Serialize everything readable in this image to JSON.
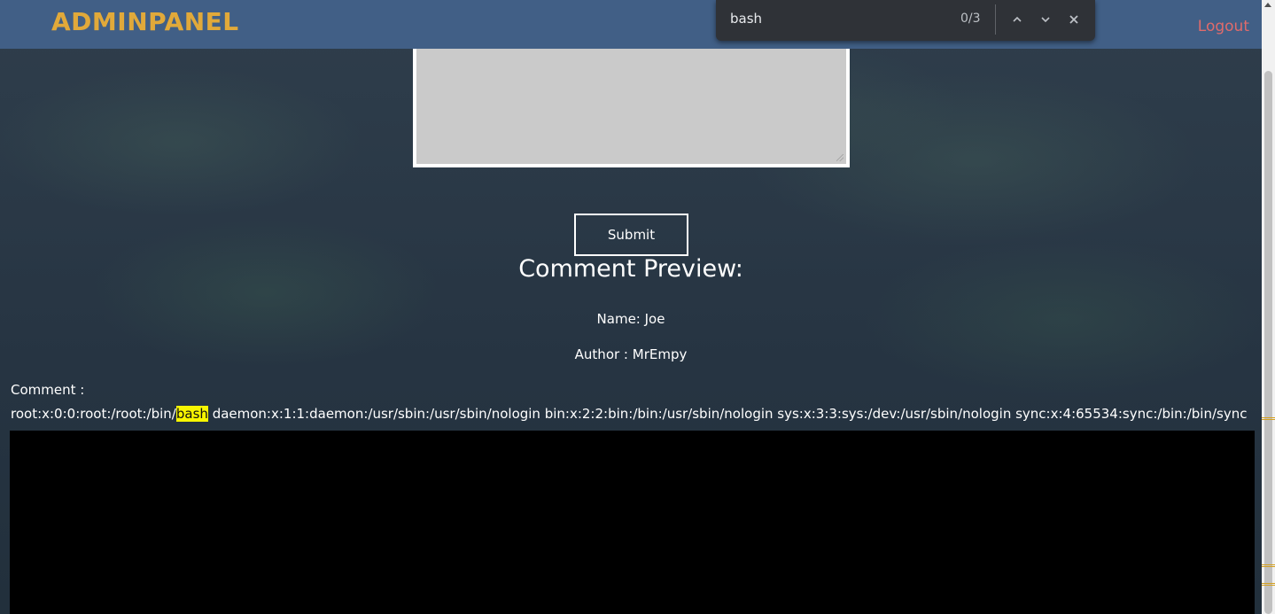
{
  "navbar": {
    "brand": "ADMINPANEL",
    "logout_label": "Logout"
  },
  "form": {
    "submit_label": "Submit"
  },
  "preview": {
    "title": "Comment Preview:",
    "name_line": "Name: Joe",
    "author_line": "Author : MrEmpy",
    "comment_label": "Comment :",
    "comment_prefix": "root:x:0:0:root:/root:/bin/",
    "comment_highlight": "bash",
    "comment_suffix": " daemon:x:1:1:daemon:/usr/sbin:/usr/sbin/nologin bin:x:2:2:bin:/bin:/usr/sbin/nologin sys:x:3:3:sys:/dev:/usr/sbin/nologin sync:x:4:65534:sync:/bin:/bin/sync"
  },
  "find_bar": {
    "query": "bash",
    "count": "0/3"
  },
  "icons": {
    "find_prev": "chevron-up-icon",
    "find_next": "chevron-down-icon",
    "find_close": "close-icon"
  },
  "colors": {
    "navbar_bg": "#415f86",
    "brand": "#e1a93a",
    "logout": "#e06b6b",
    "find_highlight": "#f7f500"
  }
}
